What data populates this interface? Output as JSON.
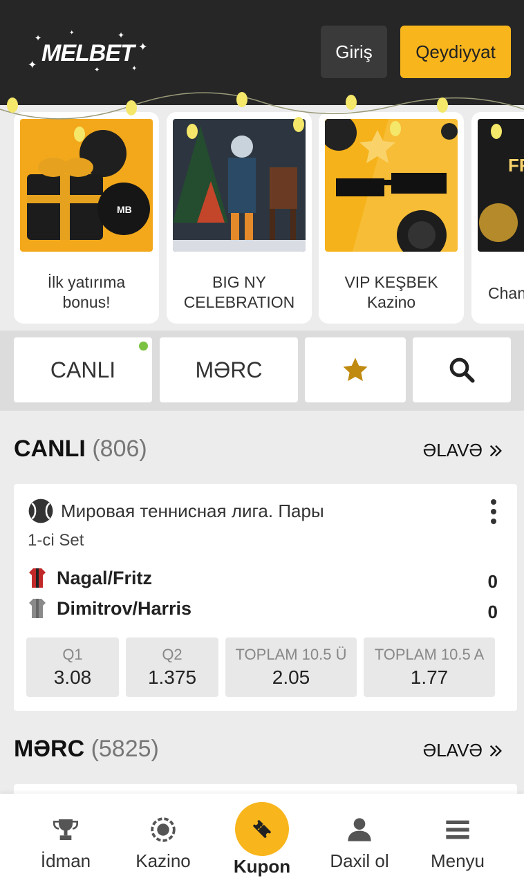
{
  "header": {
    "logo_text_prefix": "MEL",
    "logo_text_suffix": "BET",
    "login_label": "Giriş",
    "register_label": "Qeydiyyat"
  },
  "promos": [
    {
      "caption": "İlk yatırıma bonus!"
    },
    {
      "caption": "BIG NY CELEBRATION"
    },
    {
      "caption": "VIP KEŞBEK Kazino"
    },
    {
      "caption": "Chan",
      "image_text": "FR"
    }
  ],
  "nav": {
    "live_label": "CANLI",
    "bet_label": "MƏRC",
    "favorites_icon": "star-icon",
    "search_icon": "search-icon"
  },
  "live_section": {
    "title": "CANLI",
    "count": "(806)",
    "more_label": "ƏLAVƏ"
  },
  "match": {
    "league": "Мировая теннисная лига. Пары",
    "period": "1-ci Set",
    "teams": [
      {
        "name": "Nagal/Fritz",
        "score": "0"
      },
      {
        "name": "Dimitrov/Harris",
        "score": "0"
      }
    ],
    "odds": [
      {
        "label": "Q1",
        "value": "3.08"
      },
      {
        "label": "Q2",
        "value": "1.375"
      },
      {
        "label": "TOPLAM 10.5 Ü",
        "value": "2.05"
      },
      {
        "label": "TOPLAM 10.5 A",
        "value": "1.77"
      }
    ]
  },
  "bet_section": {
    "title": "MƏRC",
    "count": "(5825)",
    "more_label": "ƏLAVƏ"
  },
  "bottom_nav": {
    "items": [
      {
        "label": "İdman",
        "icon": "trophy-icon"
      },
      {
        "label": "Kazino",
        "icon": "casino-chip-icon"
      },
      {
        "label": "Kupon",
        "icon": "ticket-icon"
      },
      {
        "label": "Daxil ol",
        "icon": "user-icon"
      },
      {
        "label": "Menyu",
        "icon": "menu-icon"
      }
    ]
  },
  "colors": {
    "brand_yellow": "#f8b51c",
    "header_bg": "#262626",
    "live_dot": "#7bc242"
  }
}
